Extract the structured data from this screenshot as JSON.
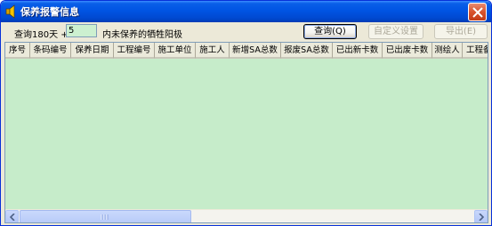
{
  "window": {
    "title": "保养报警信息"
  },
  "toolbar": {
    "query_prefix": "查询180天 +",
    "days_value": "5",
    "query_suffix": "内未保养的牺牲阳极",
    "query_button": "查询(Q)",
    "custom_settings_button": "自定义设置",
    "export_button": "导出(E)"
  },
  "grid": {
    "columns": [
      "序号",
      "条码编号",
      "保养日期",
      "工程编号",
      "施工单位",
      "施工人",
      "新增SA总数",
      "报废SA总数",
      "已出新卡数",
      "已出废卡数",
      "测绘人",
      "工程备"
    ],
    "rows": []
  },
  "colors": {
    "title_bar": "#0054e3",
    "grid_background": "#c6ecca",
    "window_background": "#ece9d8"
  }
}
